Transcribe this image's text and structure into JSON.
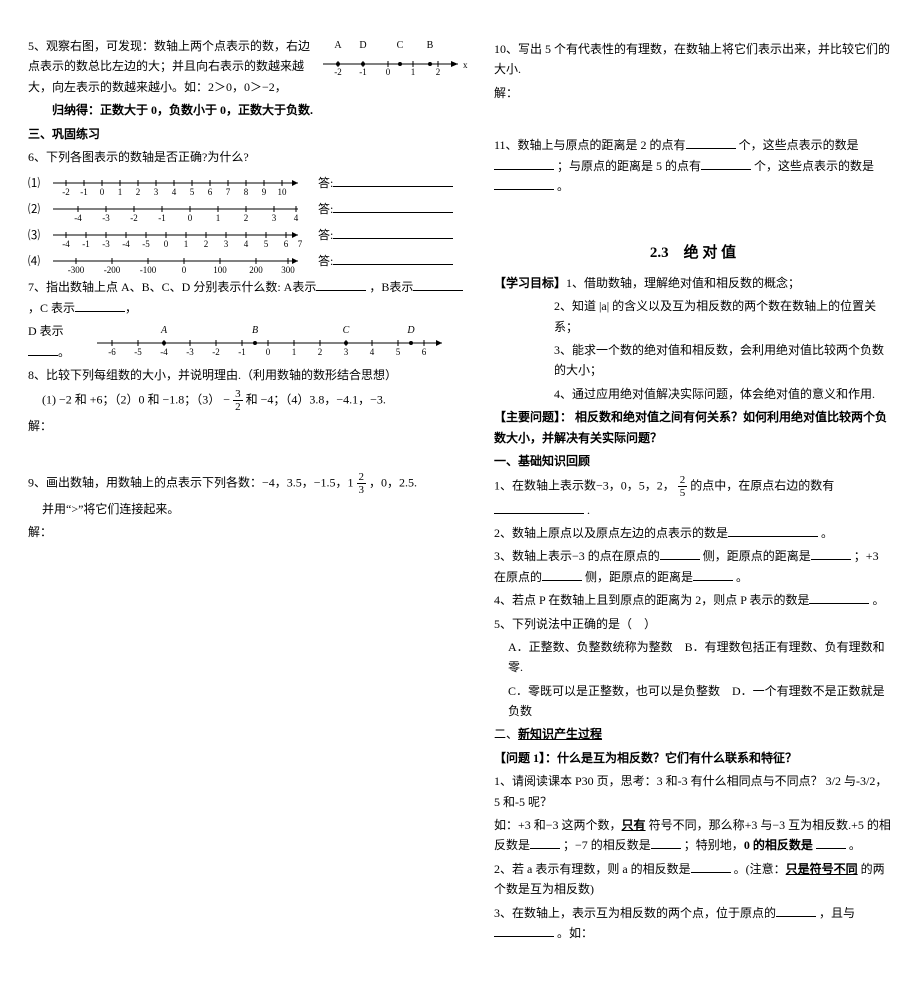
{
  "left": {
    "q5": "5、观察右图，可发现：数轴上两个点表示的数，右边点表示的数总比左边的大；并且向右表示的数越来越大，向左表示的数越来越小。如：2＞0，0＞−2，",
    "fig5_labels": [
      "A",
      "D",
      "C",
      "B"
    ],
    "fig5_ticks": [
      "-2",
      "−1",
      "0",
      "1",
      "2"
    ],
    "fig5_axis": "x",
    "summary": "归纳得：正数大于 0，负数小于 0，正数大于负数.",
    "section3": "三、巩固练习",
    "q6": "6、下列各图表示的数轴是否正确?为什么?",
    "q6_ticks": {
      "r1": [
        "−2",
        "−1",
        "0",
        "1",
        "2",
        "3",
        "4",
        "5",
        "6",
        "7",
        "8",
        "9",
        "10"
      ],
      "r2": [
        "−4",
        "−3",
        "−2",
        "−1",
        "0",
        "1",
        "2",
        "3",
        "4"
      ],
      "r3": [
        "−4",
        "−1",
        "−3",
        "−4",
        "−5",
        "0",
        "1",
        "2",
        "3",
        "4",
        "5",
        "6",
        "7"
      ],
      "r4": [
        "−300",
        "−200",
        "−100",
        "0",
        "100",
        "200",
        "300"
      ]
    },
    "ans_label": "答:",
    "q7a": "7、指出数轴上点 A、B、C、D 分别表示什么数: A表示",
    "q7b": "，B表示",
    "q7c": "，C 表示",
    "q7d": "D 表示",
    "q7_period": "。",
    "q7_labels": [
      "A",
      "B",
      "C",
      "D"
    ],
    "q7_ticks": [
      "−6",
      "−5",
      "−4",
      "−3",
      "−2",
      "−1",
      "0",
      "1",
      "2",
      "3",
      "4",
      "5",
      "6"
    ],
    "q8": "8、比较下列每组数的大小，并说明理由.（利用数轴的数形结合思想）",
    "q8_items": "(1) −2 和 +6；（2）0 和 −1.8；（3） −",
    "q8_items_b": " 和 −4；（4）3.8，−4.1，−3.",
    "solution": "解：",
    "q9a": "9、画出数轴，用数轴上的点表示下列各数：−4，3.5，−1.5，1",
    "q9b": "，0，2.5.",
    "q9c": "并用“>”将它们连接起来。"
  },
  "right": {
    "q10": "10、写出 5 个有代表性的有理数，在数轴上将它们表示出来，并比较它们的大小.",
    "solution": "解：",
    "q11a": "11、数轴上与原点的距离是 2 的点有",
    "q11b": "个，这些点表示的数是",
    "q11c": "；与原点的距离是 5 的点有",
    "q11d": "个，这些点表示的数是",
    "q11e": "。",
    "title": "2.3　绝 对 值",
    "goals_head": "【学习目标】",
    "g1": "1、借助数轴，理解绝对值和相反数的概念；",
    "g2": "2、知道 |a| 的含义以及互为相反数的两个数在数轴上的位置关系；",
    "g3": "3、能求一个数的绝对值和相反数，会利用绝对值比较两个负数的大小；",
    "g4": "4、通过应用绝对值解决实际问题，体会绝对值的意义和作用.",
    "main_head": "【主要问题】：",
    "main_body": "相反数和绝对值之间有何关系？如何利用绝对值比较两个负数大小，并解决有关实际问题？",
    "sec1": "一、基础知识回顾",
    "b1a": "1、在数轴上表示数−3，0，5，2，",
    "b1b": "的点中，在原点右边的数有",
    "b1c": ".",
    "b2a": "2、数轴上原点以及原点左边的点表示的数是",
    "b2b": "。",
    "b3a": "3、数轴上表示−3 的点在原点的",
    "b3b": "侧，距原点的距离是",
    "b3c": "；+3 在原点的",
    "b3d": "侧，距原点的距离是",
    "b3e": "。",
    "b4a": "4、若点 P 在数轴上且到原点的距离为 2，则点 P 表示的数是",
    "b4b": "。",
    "b5": "5、下列说法中正确的是（　）",
    "b5a": "A．正整数、负整数统称为整数　B．有理数包括正有理数、负有理数和零.",
    "b5b": "C．零既可以是正整数，也可以是负整数　D．一个有理数不是正数就是负数",
    "sec2": "二、新知识产生过程",
    "p1_head": "【问题 1】：什么是互为相反数？它们有什么联系和特征？",
    "p1a": "1、请阅读课本 P30 页，思考：3 和-3 有什么相同点与不同点？ 3/2 与-3/2，5 和-5 呢？",
    "p1b_a": "如：+3 和−3 这两个数，",
    "p1b_b": "只有",
    "p1b_c": "符号不同，那么称+3 与−3 互为相反数.+5 的相反数是",
    "p1b_d": "；−7 的相反数是",
    "p1b_e": "；特别地，",
    "p1b_f": "0 的相反数是",
    "p1b_g": "。",
    "p2a": "2、若 a 表示有理数，则 a 的相反数是",
    "p2b": "。(注意：",
    "p2c": "只是符号不同",
    "p2d": "的两个数是互为相反数)",
    "p3a": "3、在数轴上，表示互为相反数的两个点，位于原点的",
    "p3b": "，且与",
    "p3c": "。如："
  }
}
